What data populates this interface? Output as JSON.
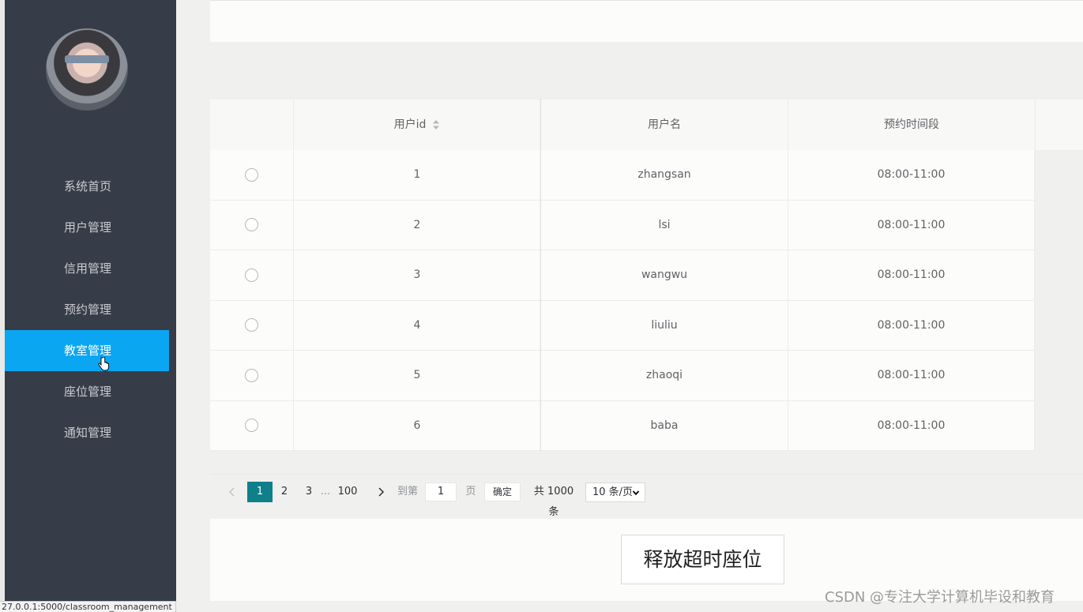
{
  "sidebar": {
    "menu": [
      {
        "label": "系统首页"
      },
      {
        "label": "用户管理"
      },
      {
        "label": "信用管理"
      },
      {
        "label": "预约管理"
      },
      {
        "label": "教室管理"
      },
      {
        "label": "座位管理"
      },
      {
        "label": "通知管理"
      }
    ],
    "active_index": 4
  },
  "status_bar": {
    "url": "27.0.0.1:5000/classroom_management"
  },
  "table": {
    "columns": [
      "",
      "用户id",
      "用户名",
      "预约时间段"
    ],
    "rows": [
      {
        "id": "1",
        "username": "zhangsan",
        "slot": "08:00-11:00"
      },
      {
        "id": "2",
        "username": "lsi",
        "slot": "08:00-11:00"
      },
      {
        "id": "3",
        "username": "wangwu",
        "slot": "08:00-11:00"
      },
      {
        "id": "4",
        "username": "liuliu",
        "slot": "08:00-11:00"
      },
      {
        "id": "5",
        "username": "zhaoqi",
        "slot": "08:00-11:00"
      },
      {
        "id": "6",
        "username": "baba",
        "slot": "08:00-11:00"
      }
    ]
  },
  "pagination": {
    "pages": [
      "1",
      "2",
      "3",
      "...",
      "100"
    ],
    "current": "1",
    "goto_label": "到第",
    "goto_value": "1",
    "page_unit": "页",
    "confirm_label": "确定",
    "total_label": "共 1000 条",
    "page_size_label": "10 条/页"
  },
  "actions": {
    "release_label": "释放超时座位"
  },
  "watermark": "CSDN @专注大学计算机毕设和教育",
  "colors": {
    "sidebar": "#363d48",
    "active_menu": "#0aa6f2",
    "pager_active": "#0f7f8a"
  }
}
